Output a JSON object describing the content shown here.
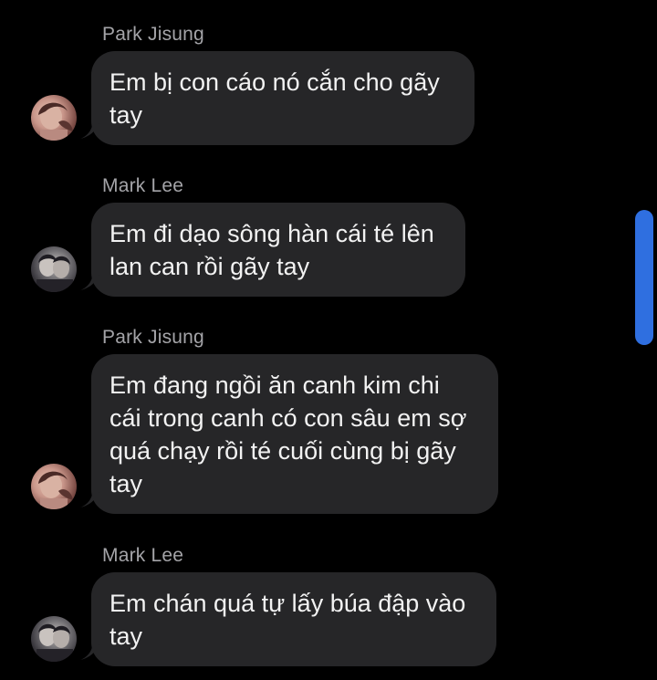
{
  "conversation": {
    "messages": [
      {
        "sender": "Park Jisung",
        "lines": [
          "Em bị con cáo nó cắn cho gãy",
          "tay"
        ]
      },
      {
        "sender": "Mark Lee",
        "lines": [
          "Em đi dạo sông hàn cái té lên",
          "lan can rồi gãy tay"
        ]
      },
      {
        "sender": "Park Jisung",
        "lines": [
          "Em đang ngồi ăn canh kim chi",
          "cái trong canh có con sâu em sợ",
          "quá chạy rồi té cuối cùng bị gãy",
          "tay"
        ]
      },
      {
        "sender": "Mark Lee",
        "lines": [
          "Em chán quá tự lấy búa đập vào",
          "tay"
        ]
      }
    ]
  },
  "colors": {
    "background": "#000000",
    "bubble": "#262628",
    "sender_text": "#a4a4a8",
    "message_text": "#f2f2f2",
    "scrollbar": "#2f6fe0"
  },
  "icons": {
    "avatar_park": "profile-photo",
    "avatar_mark": "profile-photo"
  }
}
